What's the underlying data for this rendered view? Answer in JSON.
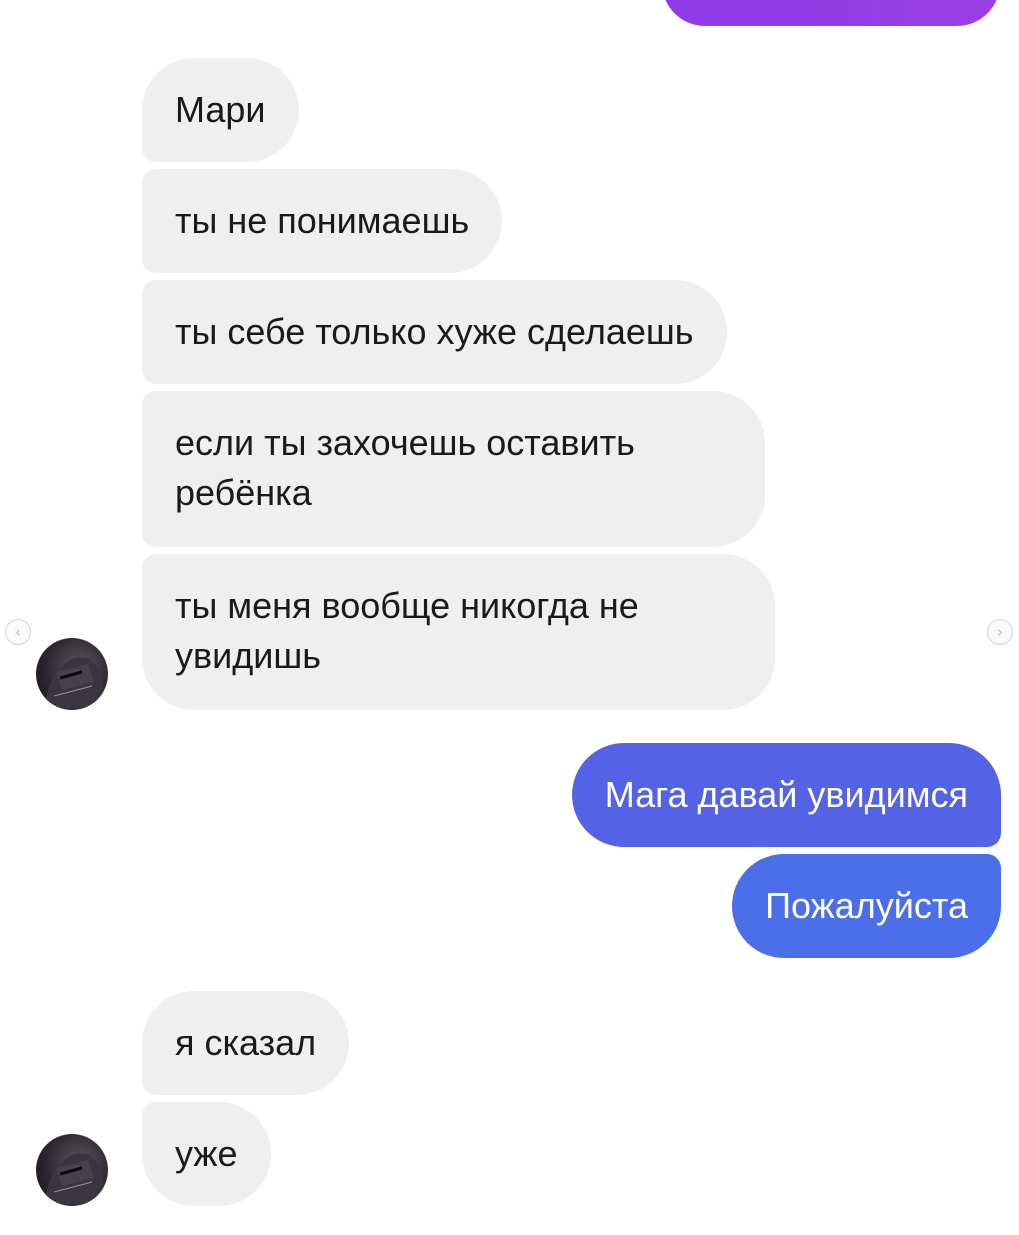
{
  "messages": [
    {
      "text": "Мари"
    },
    {
      "text": "ты не понимаешь"
    },
    {
      "text": "ты себе только хуже сделаешь"
    },
    {
      "line1": "если ты захочешь оставить",
      "line2": "ребёнка"
    },
    {
      "line1": "ты меня вообще никогда не",
      "line2": "увидишь"
    },
    {
      "text": "Мага давай увидимся"
    },
    {
      "text": "Пожалуйста"
    },
    {
      "text": "я сказал"
    },
    {
      "text": "уже"
    }
  ],
  "nav": {
    "prev_icon": "‹",
    "next_icon": "›"
  },
  "colors": {
    "incoming_bubble": "#efefef",
    "outgoing_top": "#9a3fe6",
    "outgoing_mid": "#5463e6",
    "outgoing_bottom": "#4a6fe8"
  },
  "icons": {
    "avatar": "contact-avatar",
    "prev": "chevron-left-icon",
    "next": "chevron-right-icon"
  }
}
